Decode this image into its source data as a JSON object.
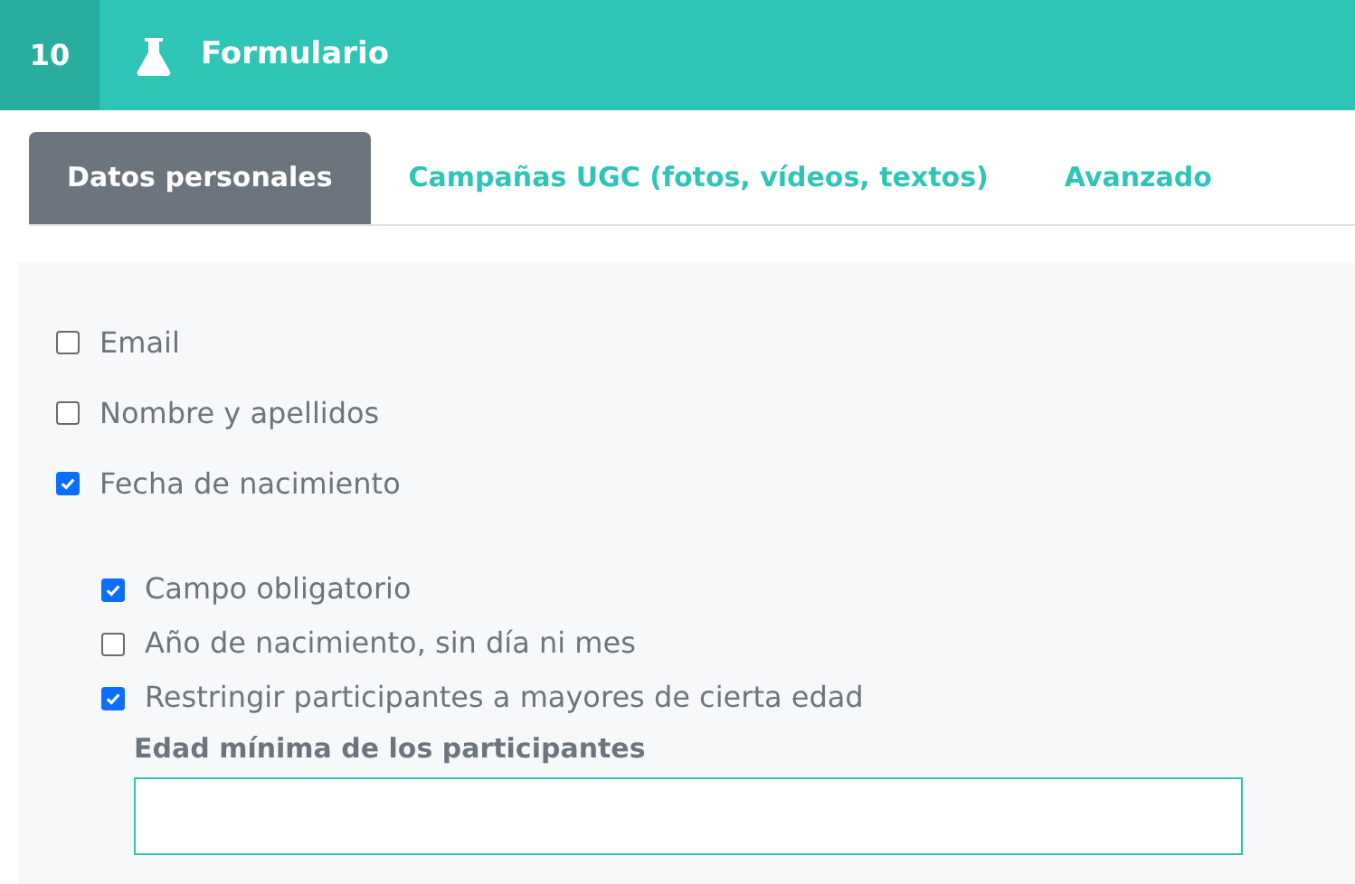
{
  "header": {
    "number": "10",
    "title": "Formulario"
  },
  "tabs": [
    {
      "label": "Datos personales",
      "selected": true
    },
    {
      "label": "Campañas UGC (fotos, vídeos, textos)",
      "selected": false
    },
    {
      "label": "Avanzado",
      "selected": false
    }
  ],
  "fields": [
    {
      "label": "Email",
      "checked": false
    },
    {
      "label": "Nombre y apellidos",
      "checked": false
    },
    {
      "label": "Fecha de nacimiento",
      "checked": true,
      "children": [
        {
          "label": "Campo obligatorio",
          "checked": true
        },
        {
          "label": "Año de nacimiento, sin día ni mes",
          "checked": false
        },
        {
          "label": "Restringir participantes a mayores de cierta edad",
          "checked": true
        }
      ]
    }
  ],
  "min_age": {
    "label": "Edad mínima de los participantes"
  }
}
